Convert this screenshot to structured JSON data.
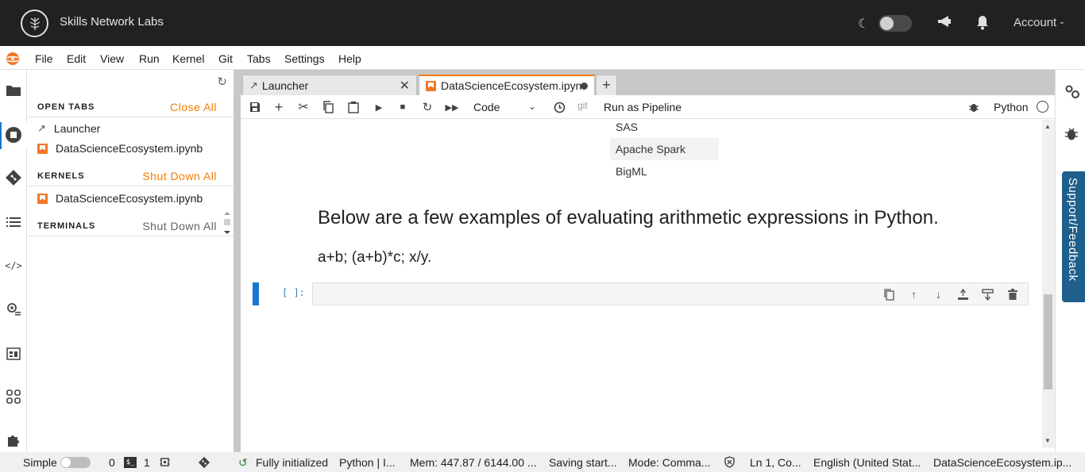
{
  "topbar": {
    "brand": "Skills Network Labs",
    "account_label": "Account"
  },
  "menubar": {
    "items": [
      "File",
      "Edit",
      "View",
      "Run",
      "Kernel",
      "Git",
      "Tabs",
      "Settings",
      "Help"
    ]
  },
  "sidepanel": {
    "open_tabs": {
      "title": "OPEN TABS",
      "action": "Close All",
      "items": [
        "Launcher",
        "DataScienceEcosystem.ipynb"
      ]
    },
    "kernels": {
      "title": "KERNELS",
      "action": "Shut Down All",
      "items": [
        "DataScienceEcosystem.ipynb"
      ]
    },
    "terminals": {
      "title": "TERMINALS",
      "action": "Shut Down All"
    }
  },
  "tabs": [
    {
      "label": "Launcher",
      "active": false
    },
    {
      "label": "DataScienceEcosystem.ipyn",
      "active": true
    }
  ],
  "toolbar": {
    "cell_type": "Code",
    "git_label": "git",
    "pipeline_label": "Run as Pipeline",
    "kernel_name": "Python"
  },
  "notebook": {
    "list_items": [
      "SAS",
      "Apache Spark",
      "BigML"
    ],
    "markdown_heading": "Below are a few examples of evaluating arithmetic expressions in Python.",
    "markdown_text": "a+b; (a+b)*c; x/y.",
    "cell_prompt": "[ ]:"
  },
  "right_panel": {
    "support_label": "Support/Feedback"
  },
  "statusbar": {
    "simple_label": "Simple",
    "terminals_count": "0",
    "kernels_count": "1",
    "kernel_status": "Fully initialized",
    "kernel_info": "Python | I...",
    "memory": "Mem: 447.87 / 6144.00 ...",
    "saving": "Saving start...",
    "mode": "Mode: Comma...",
    "cursor": "Ln 1, Co...",
    "language": "English (United Stat...",
    "filename": "DataScienceEcosystem.ip..."
  },
  "colors": {
    "accent": "#f57c00",
    "brand_blue": "#1976d2",
    "topbar_bg": "#212121",
    "support_bg": "#1f5f8b"
  }
}
